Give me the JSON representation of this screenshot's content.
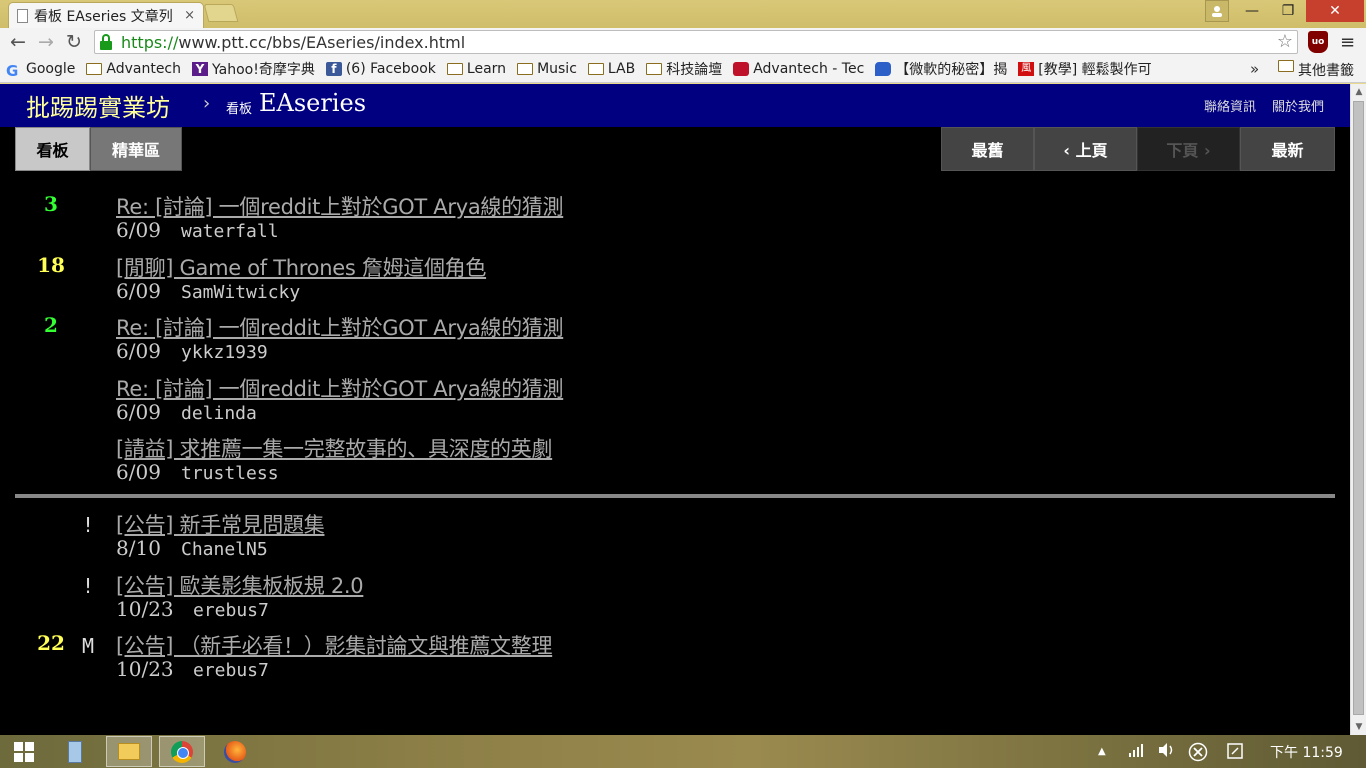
{
  "browser": {
    "tab_title": "看板 EAseries 文章列",
    "tab_close": "×",
    "url_scheme": "https://",
    "url_rest": "www.ptt.cc/bbs/EAseries/index.html",
    "star_icon": "star-icon",
    "window_controls": {
      "minimize": "—",
      "maximize": "❐",
      "close": "✕"
    },
    "nav": {
      "back": "←",
      "forward": "→",
      "reload": "↻"
    },
    "menu_glyph": "≡",
    "bookmarks": [
      {
        "label": "Google",
        "icon": "google-icon"
      },
      {
        "label": "Advantech",
        "icon": "folder-icon"
      },
      {
        "label": "Yahoo!奇摩字典",
        "icon": "yahoo-icon"
      },
      {
        "label": "(6) Facebook",
        "icon": "facebook-icon"
      },
      {
        "label": "Learn",
        "icon": "folder-icon"
      },
      {
        "label": "Music",
        "icon": "folder-icon"
      },
      {
        "label": "LAB",
        "icon": "folder-icon"
      },
      {
        "label": "科技論壇",
        "icon": "folder-icon"
      },
      {
        "label": "Advantech - Tec",
        "icon": "advantech-icon"
      },
      {
        "label": "【微軟的秘密】揭",
        "icon": "blue-icon"
      },
      {
        "label": "[教學] 輕鬆製作可",
        "icon": "red-icon"
      }
    ],
    "bookmarks_more": "»",
    "other_bookmarks": "其他書籤"
  },
  "ptt": {
    "site_name": "批踢踢實業坊",
    "breadcrumb_sep": "›",
    "board_label": "看板",
    "board_name": "EAseries",
    "links": {
      "contact": "聯絡資訊",
      "about": "關於我們"
    },
    "tabs": {
      "board": "看板",
      "digest": "精華區"
    },
    "paging": {
      "oldest": "最舊",
      "prev": "‹ 上頁",
      "next": "下頁 ›",
      "latest": "最新"
    },
    "posts": [
      {
        "nrec": "3",
        "nrec_color": "green",
        "mark": "",
        "title": "Re: [討論] 一個reddit上對於GOT Arya線的猜測",
        "date": "6/09",
        "author": "waterfall"
      },
      {
        "nrec": "18",
        "nrec_color": "yellow",
        "mark": "",
        "title": "[閒聊] Game of Thrones 詹姆這個角色",
        "date": "6/09",
        "author": "SamWitwicky"
      },
      {
        "nrec": "2",
        "nrec_color": "green",
        "mark": "",
        "title": "Re: [討論] 一個reddit上對於GOT Arya線的猜測",
        "date": "6/09",
        "author": "ykkz1939"
      },
      {
        "nrec": "",
        "nrec_color": "",
        "mark": "",
        "title": "Re: [討論] 一個reddit上對於GOT Arya線的猜測",
        "date": "6/09",
        "author": "delinda"
      },
      {
        "nrec": "",
        "nrec_color": "",
        "mark": "",
        "title": "[請益] 求推薦一集一完整故事的、具深度的英劇",
        "date": "6/09",
        "author": "trustless"
      }
    ],
    "pinned": [
      {
        "nrec": "",
        "nrec_color": "",
        "mark": "!",
        "title": "[公告] 新手常見問題集",
        "date": "8/10",
        "author": "ChanelN5"
      },
      {
        "nrec": "",
        "nrec_color": "",
        "mark": "!",
        "title": "[公告] 歐美影集板板規 2.0",
        "date": "10/23",
        "author": "erebus7"
      },
      {
        "nrec": "22",
        "nrec_color": "yellow",
        "mark": "M",
        "title": "[公告] （新手必看！）影集討論文與推薦文整理",
        "date": "10/23",
        "author": "erebus7"
      }
    ]
  },
  "taskbar": {
    "clock": "下午 11:59",
    "tray": {
      "up": "▲",
      "signal": "▮",
      "volume": "🔊",
      "close": "⊗",
      "doc": "▢"
    }
  }
}
